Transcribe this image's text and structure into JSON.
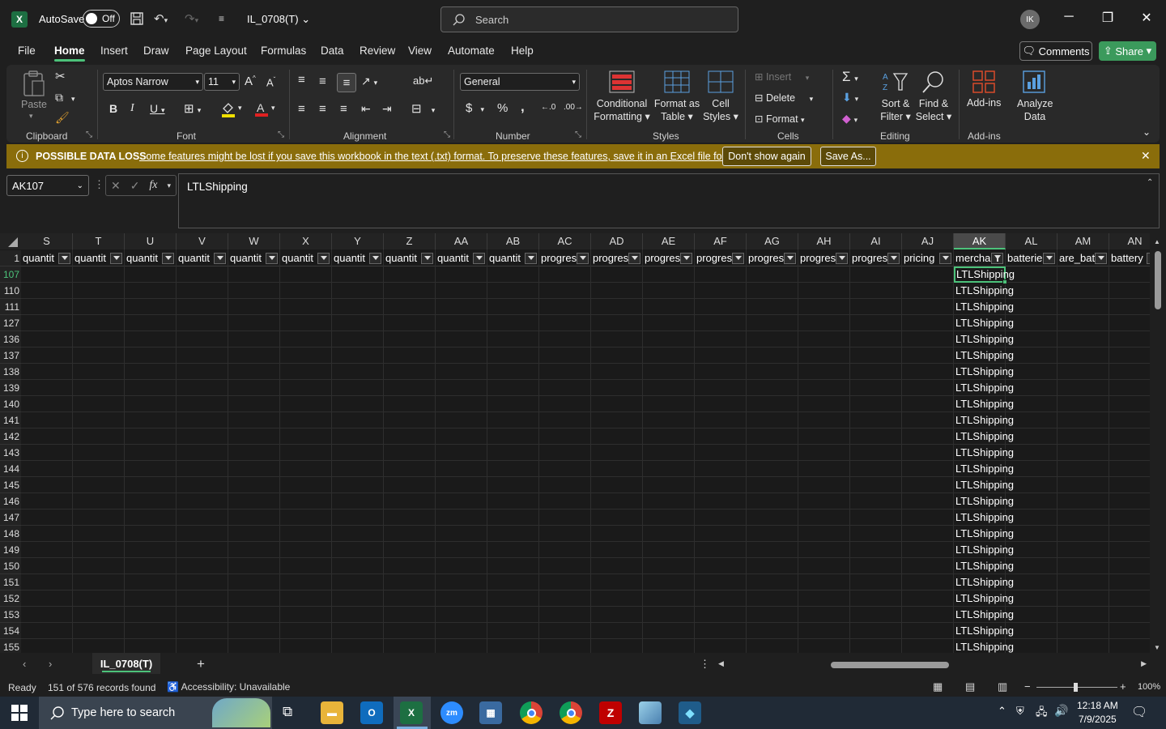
{
  "titlebar": {
    "autosave_label": "AutoSave",
    "autosave_state": "Off",
    "filename": "IL_0708(T)",
    "search_placeholder": "Search",
    "avatar_initials": "IK"
  },
  "menu": [
    "File",
    "Home",
    "Insert",
    "Draw",
    "Page Layout",
    "Formulas",
    "Data",
    "Review",
    "View",
    "Automate",
    "Help"
  ],
  "active_menu": "Home",
  "header_buttons": {
    "comments": "Comments",
    "share": "Share"
  },
  "ribbon": {
    "groups": {
      "clipboard": "Clipboard",
      "font": "Font",
      "alignment": "Alignment",
      "number": "Number",
      "styles": "Styles",
      "cells": "Cells",
      "editing": "Editing",
      "addins": "Add-ins"
    },
    "paste": "Paste",
    "font_name": "Aptos Narrow",
    "font_size": "11",
    "number_format": "General",
    "conditional_formatting": [
      "Conditional",
      "Formatting"
    ],
    "format_as_table": [
      "Format as",
      "Table"
    ],
    "cell_styles": [
      "Cell",
      "Styles"
    ],
    "insert": "Insert",
    "delete": "Delete",
    "format": "Format",
    "sort_filter": [
      "Sort &",
      "Filter"
    ],
    "find_select": [
      "Find &",
      "Select"
    ],
    "addins": "Add-ins",
    "analyze_data": [
      "Analyze",
      "Data"
    ]
  },
  "message_bar": {
    "title": "POSSIBLE DATA LOSS",
    "text": "Some features might be lost if you save this workbook in the text (.txt) format. To preserve these features, save it in an Excel file format.",
    "dont_show": "Don't show again",
    "save_as": "Save As..."
  },
  "name_box": "AK107",
  "formula_bar": "LTLShipping",
  "columns": [
    "S",
    "T",
    "U",
    "V",
    "W",
    "X",
    "Y",
    "Z",
    "AA",
    "AB",
    "AC",
    "AD",
    "AE",
    "AF",
    "AG",
    "AH",
    "AI",
    "AJ",
    "AK",
    "AL",
    "AM",
    "AN"
  ],
  "selected_column": "AK",
  "header_row_number": "1",
  "header_row": [
    "quantit",
    "quantit",
    "quantit",
    "quantit",
    "quantit",
    "quantit",
    "quantit",
    "quantit",
    "quantit",
    "quantit",
    "progres",
    "progres",
    "progres",
    "progres",
    "progres",
    "progres",
    "progres",
    "pricing",
    "mercha",
    "batterie",
    "are_bat",
    "battery"
  ],
  "rows": [
    "107",
    "110",
    "111",
    "127",
    "136",
    "137",
    "138",
    "139",
    "140",
    "141",
    "142",
    "143",
    "144",
    "145",
    "146",
    "147",
    "148",
    "149",
    "150",
    "151",
    "152",
    "153",
    "154",
    "155"
  ],
  "selected_row": "107",
  "ak_values": [
    "LTLShipping",
    "LTLShipping",
    "LTLShipping",
    "LTLShipping",
    "LTLShipping",
    "LTLShipping",
    "LTLShipping",
    "LTLShipping",
    "LTLShipping",
    "LTLShipping",
    "LTLShipping",
    "LTLShipping",
    "LTLShipping",
    "LTLShipping",
    "LTLShipping",
    "LTLShipping",
    "LTLShipping",
    "LTLShipping",
    "LTLShipping",
    "LTLShipping",
    "LTLShipping",
    "LTLShipping",
    "LTLShipping",
    "LTLShipping"
  ],
  "sheet_tab": "IL_0708(T)",
  "status": {
    "ready": "Ready",
    "records": "151 of 576 records found",
    "accessibility": "Accessibility: Unavailable",
    "zoom": "100%"
  },
  "taskbar": {
    "search_placeholder": "Type here to search",
    "time": "12:18 AM",
    "date": "7/9/2025"
  },
  "colors": {
    "accent_green": "#4cc27a",
    "excel_green": "#1d6f42",
    "message_bar": "#8a6d0b"
  }
}
